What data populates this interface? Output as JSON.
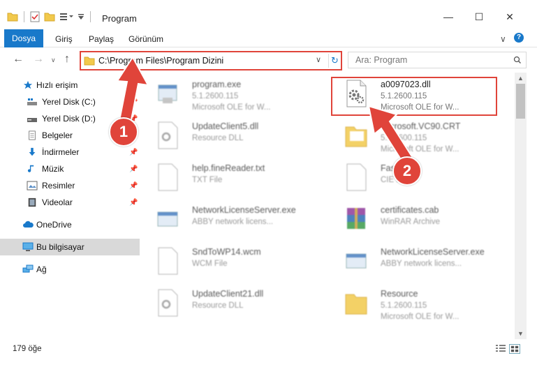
{
  "window": {
    "title": "Program",
    "minimize_glyph": "—",
    "maximize_glyph": "☐",
    "close_glyph": "✕"
  },
  "ribbon": {
    "tabs": [
      "Dosya",
      "Giriş",
      "Paylaş",
      "Görünüm"
    ],
    "help_glyph": "?",
    "collapse_glyph": "∨"
  },
  "address": {
    "path": "C:\\Program Files\\Program Dizini",
    "search_placeholder": "Ara: Program"
  },
  "sidebar": {
    "items": [
      {
        "label": "Hızlı erişim",
        "icon": "star-icon",
        "pinned": false
      },
      {
        "label": "Yerel Disk (C:)",
        "icon": "drive-icon",
        "pinned": true
      },
      {
        "label": "Yerel Disk (D:)",
        "icon": "drive-icon",
        "pinned": true
      },
      {
        "label": "Belgeler",
        "icon": "documents-icon",
        "pinned": true
      },
      {
        "label": "İndirmeler",
        "icon": "download-icon",
        "pinned": true
      },
      {
        "label": "Müzik",
        "icon": "music-icon",
        "pinned": true
      },
      {
        "label": "Resimler",
        "icon": "pictures-icon",
        "pinned": true
      },
      {
        "label": "Videolar",
        "icon": "video-icon",
        "pinned": true
      },
      {
        "label": "OneDrive",
        "icon": "cloud-icon",
        "pinned": false
      },
      {
        "label": "Bu bilgisayar",
        "icon": "computer-icon",
        "pinned": false,
        "selected": true
      },
      {
        "label": "Ağ",
        "icon": "network-icon",
        "pinned": false
      }
    ]
  },
  "files": [
    {
      "name": "program.exe",
      "line1": "5.1.2600.115",
      "line2": "Microsoft OLE for W...",
      "icon": "exe-icon",
      "highlighted": false
    },
    {
      "name": "a0097023.dll",
      "line1": "5.1.2600.115",
      "line2": "Microsoft OLE for W...",
      "icon": "dll-gear-icon",
      "highlighted": true
    },
    {
      "name": "UpdateClient5.dll",
      "line1": "Resource DLL",
      "line2": "",
      "icon": "dll-icon",
      "highlighted": false
    },
    {
      "name": "Microsoft.VC90.CRT",
      "line1": "5.1.2600.115",
      "line2": "Microsoft OLE for W...",
      "icon": "folder-icon",
      "highlighted": false
    },
    {
      "name": "help.fineReader.txt",
      "line1": "TXT File",
      "line2": "",
      "icon": "txt-icon",
      "highlighted": false
    },
    {
      "name": "FastNi...",
      "line1": "CIE File",
      "line2": "",
      "icon": "file-icon",
      "highlighted": false
    },
    {
      "name": "NetworkLicenseServer.exe",
      "line1": "ABBY network licens...",
      "line2": "",
      "icon": "exe-icon",
      "highlighted": false
    },
    {
      "name": "certificates.cab",
      "line1": "WinRAR Archive",
      "line2": "",
      "icon": "archive-icon",
      "highlighted": false
    },
    {
      "name": "SndToWP14.wcm",
      "line1": "WCM File",
      "line2": "",
      "icon": "file-icon",
      "highlighted": false
    },
    {
      "name": "NetworkLicenseServer.exe",
      "line1": "ABBY network licens...",
      "line2": "",
      "icon": "exe-icon",
      "highlighted": false
    },
    {
      "name": "UpdateClient21.dll",
      "line1": "Resource DLL",
      "line2": "",
      "icon": "dll-icon",
      "highlighted": false
    },
    {
      "name": "Resource",
      "line1": "5.1.2600.115",
      "line2": "Microsoft OLE for W...",
      "icon": "folder-icon",
      "highlighted": false
    }
  ],
  "status": {
    "count": "179 öğe"
  },
  "annotations": {
    "step1": "1",
    "step2": "2",
    "color": "#e0443a"
  },
  "colors": {
    "accent": "#1979ca",
    "highlight": "#e0443a",
    "folder": "#f2c94c"
  }
}
